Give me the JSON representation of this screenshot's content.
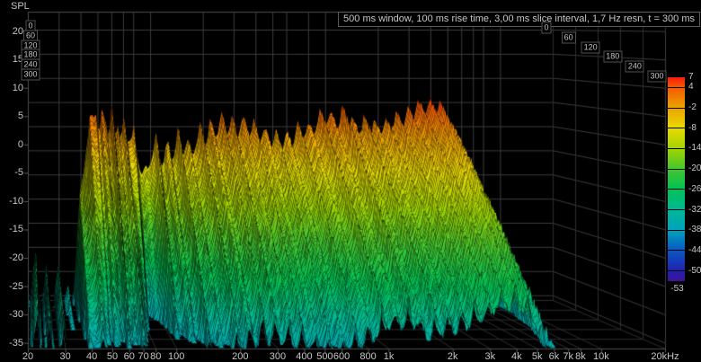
{
  "app": {
    "spl_label": "SPL"
  },
  "colors": {
    "background": "#000000",
    "grid": "#3c3c3c",
    "grid_faint": "#2e2e2e",
    "frame": "#4d4d4d",
    "text": "#c6c6c6",
    "slice_outline": "rgba(0,0,0,0.65)"
  },
  "chart_data": {
    "type": "waterfall",
    "title": "500 ms window, 100 ms rise time, 3,00 ms slice interval, 1,7 Hz resn, t = 300 ms",
    "ylabel": "SPL",
    "x_unit": "Hz",
    "x_scale": "log",
    "freq_range_hz": [
      20,
      20000
    ],
    "data_cutoff_hz": 8300,
    "spl_floor_db": -36,
    "spl_ticks": [
      20,
      15,
      10,
      5,
      0,
      -5,
      -10,
      -15,
      -20,
      -25,
      -30,
      -35
    ],
    "freq_ticks": [
      {
        "v": 20,
        "label": "20"
      },
      {
        "v": 30,
        "label": "30"
      },
      {
        "v": 40,
        "label": "40"
      },
      {
        "v": 50,
        "label": "50"
      },
      {
        "v": 60,
        "label": "60"
      },
      {
        "v": 70,
        "label": "70"
      },
      {
        "v": 80,
        "label": "80"
      },
      {
        "v": 100,
        "label": "100"
      },
      {
        "v": 200,
        "label": "200"
      },
      {
        "v": 300,
        "label": "300"
      },
      {
        "v": 400,
        "label": "400"
      },
      {
        "v": 500,
        "label": "500"
      },
      {
        "v": 600,
        "label": "600"
      },
      {
        "v": 800,
        "label": "800"
      },
      {
        "v": 1000,
        "label": "1k"
      },
      {
        "v": 2000,
        "label": "2k"
      },
      {
        "v": 3000,
        "label": "3k"
      },
      {
        "v": 4000,
        "label": "4k"
      },
      {
        "v": 5000,
        "label": "5k"
      },
      {
        "v": 6000,
        "label": "6k"
      },
      {
        "v": 7000,
        "label": "7k"
      },
      {
        "v": 8000,
        "label": "8k"
      },
      {
        "v": 10000,
        "label": "10k"
      },
      {
        "v": 20000,
        "label": "20kHz"
      }
    ],
    "time_ms": {
      "start": 0,
      "end": 300,
      "slice_interval_ms": 3,
      "labels": [
        0,
        60,
        120,
        180,
        240,
        300
      ]
    },
    "colorbar": {
      "labels": [
        7,
        4,
        -2,
        -8,
        -14,
        -20,
        -26,
        -32,
        -38,
        -44,
        -50,
        -53
      ],
      "stops": [
        {
          "db": 7,
          "color": "#fb1b10"
        },
        {
          "db": 4,
          "color": "#f55a00"
        },
        {
          "db": -2,
          "color": "#eea200"
        },
        {
          "db": -8,
          "color": "#e8da00"
        },
        {
          "db": -14,
          "color": "#a2d400"
        },
        {
          "db": -20,
          "color": "#44c62e"
        },
        {
          "db": -26,
          "color": "#00c254"
        },
        {
          "db": -32,
          "color": "#00b897"
        },
        {
          "db": -38,
          "color": "#00a2bc"
        },
        {
          "db": -44,
          "color": "#0a57c3"
        },
        {
          "db": -50,
          "color": "#2121b0"
        },
        {
          "db": -53,
          "color": "#3f1396"
        }
      ]
    },
    "spectrum_t0_db": [
      [
        20,
        -34
      ],
      [
        22,
        -24
      ],
      [
        23.5,
        -34
      ],
      [
        25.5,
        -25
      ],
      [
        27,
        -35
      ],
      [
        29.5,
        -24
      ],
      [
        31,
        -35
      ],
      [
        33.5,
        -26
      ],
      [
        35,
        -35
      ],
      [
        37,
        -24
      ],
      [
        39,
        -12
      ],
      [
        41,
        -4
      ],
      [
        44,
        4
      ],
      [
        46,
        7
      ],
      [
        49,
        9
      ],
      [
        51,
        3
      ],
      [
        53,
        6
      ],
      [
        55,
        7.5
      ],
      [
        58,
        2
      ],
      [
        60,
        6.5
      ],
      [
        63,
        1
      ],
      [
        65,
        5.5
      ],
      [
        68,
        0
      ],
      [
        71,
        3.5
      ],
      [
        74,
        1
      ],
      [
        78,
        2
      ],
      [
        82,
        0
      ],
      [
        86,
        -3
      ],
      [
        91,
        -6
      ],
      [
        96,
        -4
      ],
      [
        102,
        0
      ],
      [
        110,
        1.5
      ],
      [
        118,
        -1
      ],
      [
        126,
        2.5
      ],
      [
        134,
        1
      ],
      [
        143,
        3.5
      ],
      [
        152,
        1.5
      ],
      [
        162,
        3
      ],
      [
        172,
        0.5
      ],
      [
        183,
        2.5
      ],
      [
        195,
        3.5
      ],
      [
        208,
        2
      ],
      [
        222,
        4
      ],
      [
        238,
        2.5
      ],
      [
        255,
        4
      ],
      [
        273,
        2
      ],
      [
        292,
        4
      ],
      [
        313,
        2.5
      ],
      [
        336,
        4.5
      ],
      [
        360,
        3
      ],
      [
        386,
        5
      ],
      [
        414,
        3
      ],
      [
        444,
        5
      ],
      [
        477,
        3
      ],
      [
        512,
        4.5
      ],
      [
        549,
        2.5
      ],
      [
        589,
        4
      ],
      [
        632,
        3
      ],
      [
        678,
        4.5
      ],
      [
        728,
        3
      ],
      [
        781,
        4.5
      ],
      [
        838,
        3
      ],
      [
        899,
        4.5
      ],
      [
        965,
        3.5
      ],
      [
        1040,
        5
      ],
      [
        1180,
        4
      ],
      [
        1340,
        5.5
      ],
      [
        1520,
        4.5
      ],
      [
        1730,
        5.5
      ],
      [
        1960,
        6.5
      ],
      [
        2230,
        6
      ],
      [
        2530,
        7.5
      ],
      [
        2870,
        6.5
      ],
      [
        3260,
        7.5
      ],
      [
        3700,
        7
      ],
      [
        4200,
        7
      ],
      [
        4760,
        5.5
      ],
      [
        5400,
        3
      ],
      [
        6100,
        -1
      ],
      [
        6900,
        -6
      ],
      [
        7500,
        -11
      ],
      [
        7900,
        -17
      ],
      [
        8150,
        -22
      ],
      [
        8300,
        -27
      ]
    ],
    "decay_db_per_300ms": [
      [
        20,
        3
      ],
      [
        30,
        3
      ],
      [
        34,
        6
      ],
      [
        36,
        16
      ],
      [
        38,
        18
      ],
      [
        41,
        26
      ],
      [
        44,
        34
      ],
      [
        48,
        42
      ],
      [
        53,
        42
      ],
      [
        58,
        42
      ],
      [
        62,
        40
      ],
      [
        68,
        38
      ],
      [
        74,
        36
      ],
      [
        80,
        55
      ],
      [
        88,
        75
      ],
      [
        95,
        65
      ],
      [
        105,
        45
      ],
      [
        120,
        38
      ],
      [
        150,
        35
      ],
      [
        200,
        34
      ],
      [
        300,
        34
      ],
      [
        500,
        34
      ],
      [
        700,
        34
      ],
      [
        1000,
        33
      ],
      [
        1500,
        33
      ],
      [
        2000,
        32
      ],
      [
        3000,
        32
      ],
      [
        4000,
        32
      ],
      [
        5000,
        33
      ],
      [
        6000,
        34
      ],
      [
        7000,
        35
      ],
      [
        8300,
        36
      ]
    ],
    "texture": {
      "notches_per_decade": 16,
      "notch_depth_db": 6,
      "slow_ripple_db": 1.8,
      "jitter_db": 1.3
    }
  }
}
